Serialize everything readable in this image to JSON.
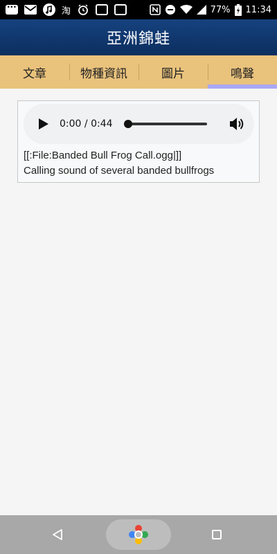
{
  "status_bar": {
    "battery": "77%",
    "time": "11:34",
    "taobao_glyph": "淘",
    "icons": [
      "chat-icon",
      "mail-icon",
      "music-icon",
      "taobao-icon",
      "alarm-icon",
      "app-icon",
      "app-icon",
      "nfc-icon",
      "dnd-icon",
      "wifi-icon",
      "signal-icon",
      "battery-icon"
    ]
  },
  "app_bar": {
    "title": "亞洲錦蛙"
  },
  "tabs": [
    {
      "label": "文章"
    },
    {
      "label": "物種資訊"
    },
    {
      "label": "圖片"
    },
    {
      "label": "鳴聲",
      "active": true
    }
  ],
  "audio": {
    "current_time": "0:00",
    "separator": " / ",
    "duration": "0:44",
    "progress": 0
  },
  "caption": {
    "file_ref": "[[:File:Banded Bull Frog Call.ogg|]]",
    "description": "Calling sound of several banded bullfrogs"
  },
  "colors": {
    "app_bar": "#0b2e5e",
    "tabs_bg": "#e9c27c",
    "tab_indicator": "#a9a8f6",
    "nav_bar": "#a8a8a8"
  }
}
